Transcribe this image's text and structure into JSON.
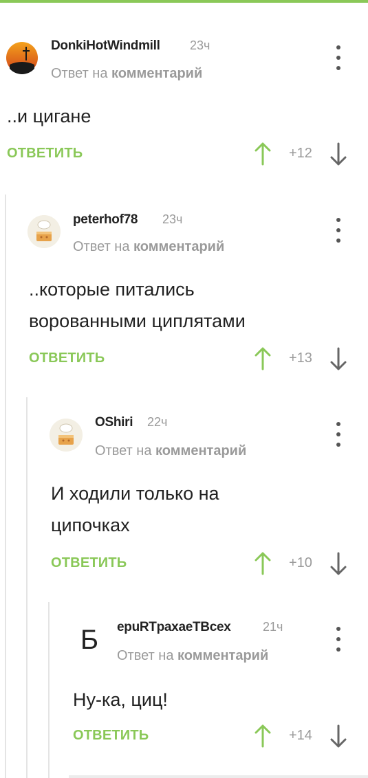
{
  "comments": [
    {
      "username": "DonkiHotWindmill",
      "time": "23ч",
      "reply_prefix": "Ответ на",
      "reply_target": "комментарий",
      "text_lines": [
        "..и цигане"
      ],
      "reply_label": "ОТВЕТИТЬ",
      "score": "+12",
      "avatar": "sunset-cross-avatar"
    },
    {
      "username": "peterhof78",
      "time": "23ч",
      "reply_prefix": "Ответ на",
      "reply_target": "комментарий",
      "text_lines": [
        "..которые питались",
        "ворованными циплятами"
      ],
      "reply_label": "ОТВЕТИТЬ",
      "score": "+13",
      "avatar": "chef-cake-avatar"
    },
    {
      "username": "OShiri",
      "time": "22ч",
      "reply_prefix": "Ответ на",
      "reply_target": "комментарий",
      "text_lines": [
        "И ходили только на",
        "ципочках"
      ],
      "reply_label": "ОТВЕТИТЬ",
      "score": "+10",
      "avatar": "chef-cake-avatar"
    },
    {
      "username": "epuRTpaxaeTBcex",
      "time": "21ч",
      "reply_prefix": "Ответ на",
      "reply_target": "комментарий",
      "text_lines": [
        "Ну-ка, циц!"
      ],
      "reply_label": "ОТВЕТИТЬ",
      "score": "+14",
      "avatar_letter": "Б"
    }
  ],
  "colors": {
    "accent": "#8ac858",
    "muted": "#9a9a9a",
    "text": "#222222"
  },
  "icons": [
    "more-vertical-icon",
    "upvote-arrow-icon",
    "downvote-arrow-icon"
  ]
}
